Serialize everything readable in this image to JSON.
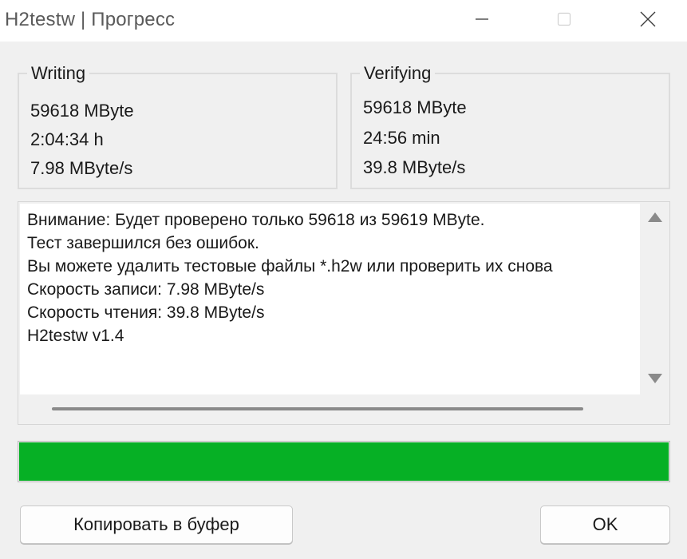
{
  "window": {
    "title": "H2testw | Прогресс"
  },
  "writing": {
    "label": "Writing",
    "size": "59618 MByte",
    "time": "2:04:34 h",
    "speed": "7.98 MByte/s"
  },
  "verifying": {
    "label": "Verifying",
    "size": "59618 MByte",
    "time": "24:56 min",
    "speed": "39.8 MByte/s"
  },
  "log": {
    "lines": [
      "Внимание: Будет проверено только 59618 из 59619 MByte.",
      "Тест завершился без ошибок.",
      "Вы можете удалить тестовые файлы *.h2w или проверить их снова",
      "Скорость записи: 7.98 MByte/s",
      "Скорость чтения: 39.8 MByte/s",
      "H2testw v1.4"
    ]
  },
  "progress": {
    "percent": 100,
    "color": "#06b025"
  },
  "buttons": {
    "copy_label": "Копировать в буфер",
    "ok_label": "OK"
  },
  "icons": {
    "minimize": "minimize-icon",
    "maximize": "maximize-icon",
    "close": "close-icon",
    "scroll_up": "arrow-up-icon",
    "scroll_down": "arrow-down-icon"
  }
}
